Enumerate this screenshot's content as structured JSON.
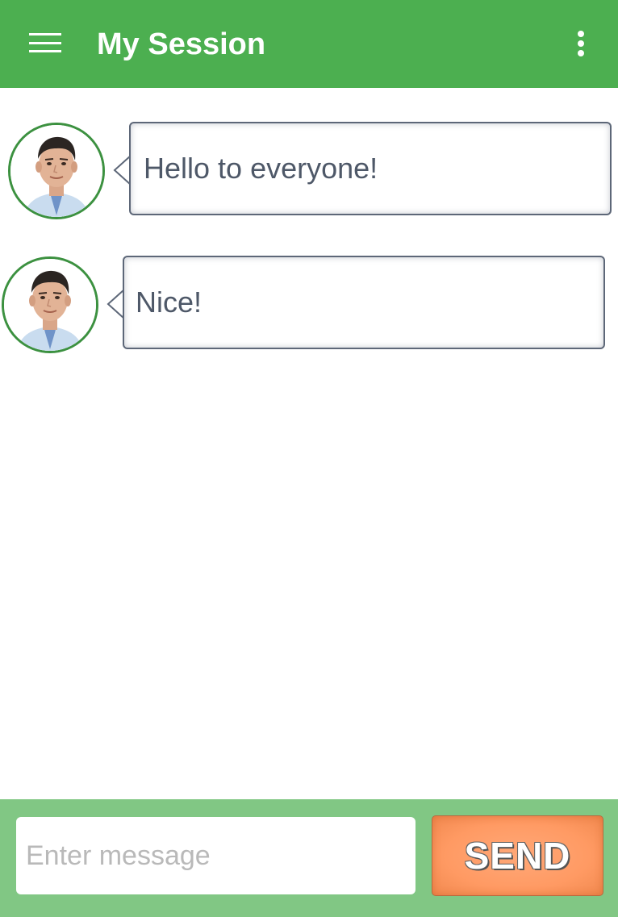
{
  "app_bar": {
    "title": "My Session",
    "menu_icon": "hamburger-menu-icon",
    "overflow_icon": "more-vertical-icon",
    "background_color": "#4caf50"
  },
  "messages": [
    {
      "text": "Hello to everyone!",
      "avatar": "user-avatar"
    },
    {
      "text": "Nice!",
      "avatar": "user-avatar"
    }
  ],
  "composer": {
    "placeholder": "Enter message",
    "value": "",
    "send_label": "SEND",
    "bar_color": "#81c784",
    "send_color": "#ff9a63"
  }
}
